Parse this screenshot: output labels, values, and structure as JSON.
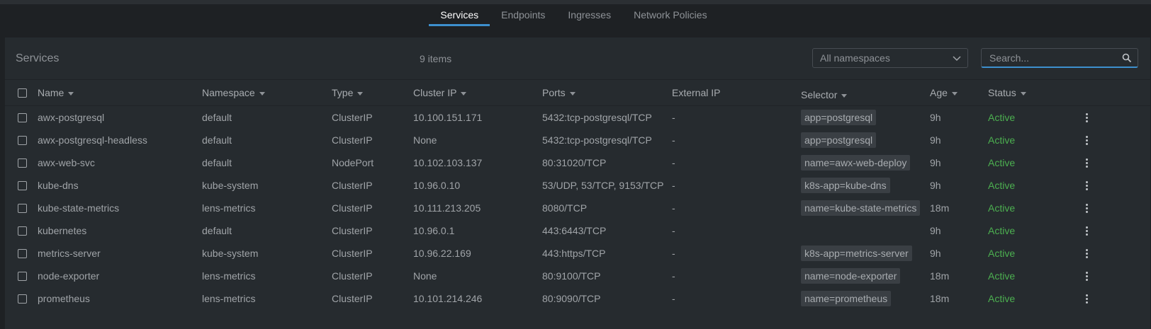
{
  "tabs": [
    {
      "label": "Services",
      "active": true
    },
    {
      "label": "Endpoints",
      "active": false
    },
    {
      "label": "Ingresses",
      "active": false
    },
    {
      "label": "Network Policies",
      "active": false
    }
  ],
  "panel": {
    "title": "Services",
    "items_count": "9 items",
    "namespace_select": "All namespaces",
    "search_placeholder": "Search..."
  },
  "columns": {
    "name": "Name",
    "namespace": "Namespace",
    "type": "Type",
    "cluster_ip": "Cluster IP",
    "ports": "Ports",
    "external_ip": "External IP",
    "selector": "Selector",
    "age": "Age",
    "status": "Status"
  },
  "rows": [
    {
      "name": "awx-postgresql",
      "namespace": "default",
      "type": "ClusterIP",
      "cluster_ip": "10.100.151.171",
      "ports": "5432:tcp-postgresql/TCP",
      "external_ip": "-",
      "selector": "app=postgresql",
      "age": "9h",
      "status": "Active"
    },
    {
      "name": "awx-postgresql-headless",
      "namespace": "default",
      "type": "ClusterIP",
      "cluster_ip": "None",
      "ports": "5432:tcp-postgresql/TCP",
      "external_ip": "-",
      "selector": "app=postgresql",
      "age": "9h",
      "status": "Active"
    },
    {
      "name": "awx-web-svc",
      "namespace": "default",
      "type": "NodePort",
      "cluster_ip": "10.102.103.137",
      "ports": "80:31020/TCP",
      "external_ip": "-",
      "selector": "name=awx-web-deploy",
      "age": "9h",
      "status": "Active"
    },
    {
      "name": "kube-dns",
      "namespace": "kube-system",
      "type": "ClusterIP",
      "cluster_ip": "10.96.0.10",
      "ports": "53/UDP, 53/TCP, 9153/TCP",
      "external_ip": "-",
      "selector": "k8s-app=kube-dns",
      "age": "9h",
      "status": "Active"
    },
    {
      "name": "kube-state-metrics",
      "namespace": "lens-metrics",
      "type": "ClusterIP",
      "cluster_ip": "10.111.213.205",
      "ports": "8080/TCP",
      "external_ip": "-",
      "selector": "name=kube-state-metrics",
      "age": "18m",
      "status": "Active"
    },
    {
      "name": "kubernetes",
      "namespace": "default",
      "type": "ClusterIP",
      "cluster_ip": "10.96.0.1",
      "ports": "443:6443/TCP",
      "external_ip": "-",
      "selector": "",
      "age": "9h",
      "status": "Active"
    },
    {
      "name": "metrics-server",
      "namespace": "kube-system",
      "type": "ClusterIP",
      "cluster_ip": "10.96.22.169",
      "ports": "443:https/TCP",
      "external_ip": "-",
      "selector": "k8s-app=metrics-server",
      "age": "9h",
      "status": "Active"
    },
    {
      "name": "node-exporter",
      "namespace": "lens-metrics",
      "type": "ClusterIP",
      "cluster_ip": "None",
      "ports": "80:9100/TCP",
      "external_ip": "-",
      "selector": "name=node-exporter",
      "age": "18m",
      "status": "Active"
    },
    {
      "name": "prometheus",
      "namespace": "lens-metrics",
      "type": "ClusterIP",
      "cluster_ip": "10.101.214.246",
      "ports": "80:9090/TCP",
      "external_ip": "-",
      "selector": "name=prometheus",
      "age": "18m",
      "status": "Active"
    }
  ],
  "colors": {
    "accent": "#3d90ce",
    "active_status": "#4caf50",
    "background": "#1e2124",
    "panel": "#262b2f"
  }
}
